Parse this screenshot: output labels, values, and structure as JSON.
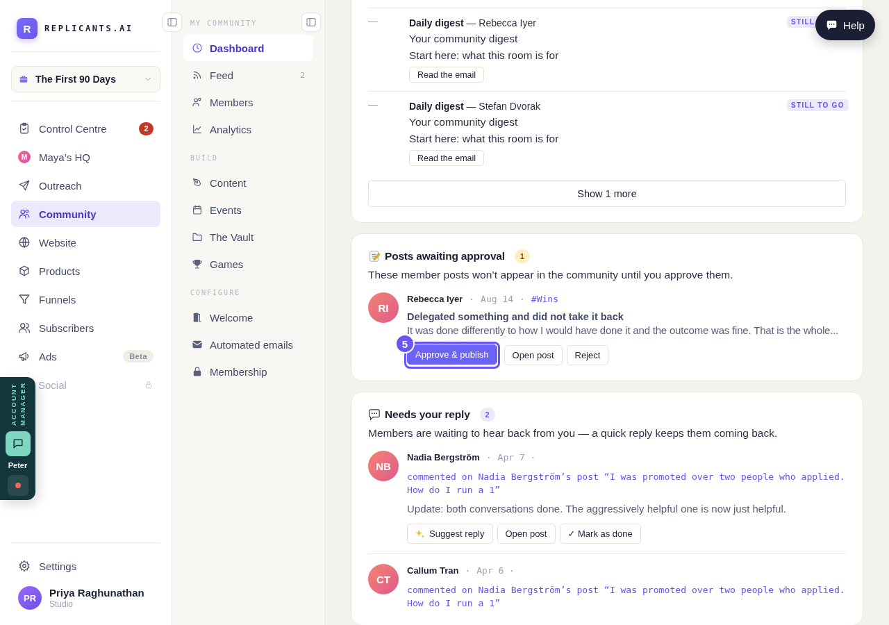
{
  "brand": {
    "logo_letter": "R",
    "name": "REPLICANTS.AI"
  },
  "workspace": {
    "label": "The First 90 Days"
  },
  "main_nav": [
    {
      "label": "Control Centre",
      "badge": "2",
      "selected": false,
      "locked": false
    },
    {
      "label": "Maya’s HQ",
      "avatar_letter": "M",
      "selected": false,
      "locked": false
    },
    {
      "label": "Outreach",
      "selected": false,
      "locked": false
    },
    {
      "label": "Community",
      "selected": true,
      "locked": false
    },
    {
      "label": "Website",
      "selected": false,
      "locked": false
    },
    {
      "label": "Products",
      "selected": false,
      "locked": false
    },
    {
      "label": "Funnels",
      "selected": false,
      "locked": false
    },
    {
      "label": "Subscribers",
      "selected": false,
      "locked": false
    },
    {
      "label": "Ads",
      "tag": "Beta",
      "selected": false,
      "locked": false
    },
    {
      "label": "Social",
      "selected": false,
      "locked": true
    }
  ],
  "account_manager": {
    "title": "ACCOUNT MANAGER",
    "name": "Peter"
  },
  "footer": {
    "settings": "Settings",
    "user": {
      "initials": "PR",
      "name": "Priya Raghunathan",
      "plan": "Studio"
    }
  },
  "community_nav": [
    {
      "title": "MY COMMUNITY",
      "items": [
        {
          "label": "Dashboard",
          "selected": true
        },
        {
          "label": "Feed",
          "count": "2",
          "selected": false
        },
        {
          "label": "Members",
          "selected": false
        },
        {
          "label": "Analytics",
          "selected": false
        }
      ]
    },
    {
      "title": "BUILD",
      "items": [
        {
          "label": "Content",
          "selected": false
        },
        {
          "label": "Events",
          "selected": false
        },
        {
          "label": "The Vault",
          "selected": false
        },
        {
          "label": "Games",
          "selected": false
        }
      ]
    },
    {
      "title": "CONFIGURE",
      "items": [
        {
          "label": "Welcome",
          "selected": false
        },
        {
          "label": "Automated emails",
          "selected": false
        },
        {
          "label": "Membership",
          "selected": false
        }
      ]
    }
  ],
  "digest_card": {
    "rows": [
      {
        "marker": "—",
        "title": "Daily digest",
        "author": "— Rebecca Iyer",
        "subject": "Your community digest",
        "lesson": "Start here: what this room is for",
        "button": "Read the email",
        "status": "STILL"
      },
      {
        "marker": "—",
        "title": "Daily digest",
        "author": "— Stefan Dvorak",
        "subject": "Your community digest",
        "lesson": "Start here: what this room is for",
        "button": "Read the email",
        "status": "STILL TO GO"
      }
    ],
    "show_more": "Show 1 more"
  },
  "approval_card": {
    "title": "Posts awaiting approval",
    "count": "1",
    "description": "These member posts won’t appear in the community until you approve them.",
    "posts": [
      {
        "initials": "RI",
        "author": "Rebecca Iyer",
        "separator": "·",
        "date": "Aug 14",
        "separator_2": "·",
        "topic": "#Wins",
        "title": "Delegated something and did not take it back",
        "excerpt": "It was done differently to how I would have done it and the outcome was fine. That is the whole...",
        "step": "5",
        "actions": [
          {
            "label": "Approve & publish",
            "kind": "primary"
          },
          {
            "label": "Open post",
            "kind": "secondary"
          },
          {
            "label": "Reject",
            "kind": "secondary"
          }
        ]
      }
    ]
  },
  "reply_card": {
    "title": "Needs your reply",
    "count": "2",
    "description": "Members are waiting to hear back from you — a quick reply keeps them coming back.",
    "items": [
      {
        "initials": "NB",
        "author": "Nadia Bergström",
        "separator": "·",
        "date": "Apr 7 ·",
        "context": "commented on Nadia Bergström’s post “I was promoted over two people who applied. How do I run a 1”",
        "body": "Update: both conversations done. The aggressively helpful one is now just helpful.",
        "actions": [
          {
            "label": "Suggest reply",
            "kind": "sparkle"
          },
          {
            "label": "Open post",
            "kind": "secondary"
          },
          {
            "label": "✓ Mark as done",
            "kind": "secondary"
          }
        ]
      },
      {
        "initials": "CT",
        "author": "Callum Tran",
        "separator": "·",
        "date": "Apr 6 ·",
        "context": "commented on Nadia Bergström’s post “I was promoted over two people who applied. How do I run a 1”"
      }
    ]
  },
  "help": {
    "label": "Help"
  }
}
